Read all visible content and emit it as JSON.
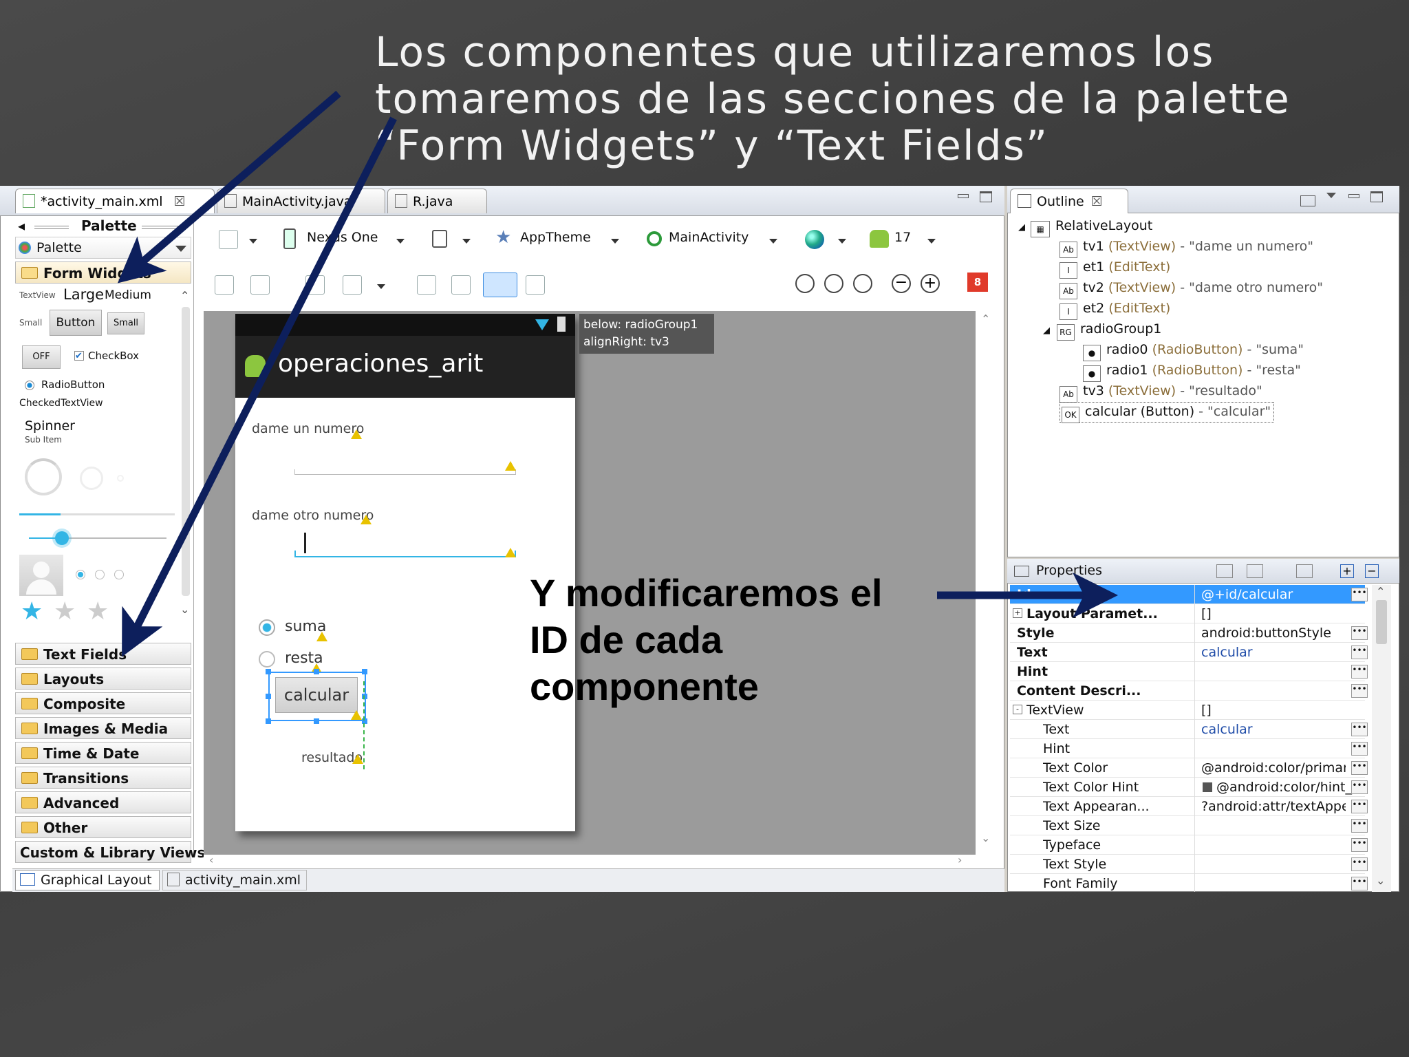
{
  "slide": {
    "title_lines": [
      "Los componentes que utilizaremos los",
      "tomaremos de las secciones de la palette",
      "“Form Widgets” y “Text Fields”"
    ],
    "note_lines": [
      "Y modificaremos el",
      "ID de cada",
      "componente"
    ]
  },
  "editor_tabs": [
    {
      "label": "*activity_main.xml",
      "close": "☒"
    },
    {
      "label": "MainActivity.java"
    },
    {
      "label": "R.java"
    }
  ],
  "palette": {
    "header": "Palette",
    "selector": "Palette",
    "open_category": "Form Widgets",
    "widgets": {
      "textview_small_label": "TextView",
      "large": "Large",
      "medium": "Medium",
      "small_label": "Small",
      "button": "Button",
      "small_button": "Small",
      "toggle_off": "OFF",
      "checkbox": "CheckBox",
      "radiobutton": "RadioButton",
      "checkedtextview": "CheckedTextView",
      "spinner": "Spinner",
      "sub_item": "Sub Item"
    },
    "categories": [
      "Text Fields",
      "Layouts",
      "Composite",
      "Images & Media",
      "Time & Date",
      "Transitions",
      "Advanced",
      "Other"
    ],
    "custom": "Custom & Library Views"
  },
  "toolbar": {
    "device": "Nexus One",
    "theme": "AppTheme",
    "activity": "MainActivity",
    "api": "17",
    "error_count": "8"
  },
  "canvas": {
    "app_title": "operaciones_arit",
    "tooltip_lines": [
      "below: radioGroup1",
      "alignRight: tv3"
    ],
    "tv1": "dame un numero",
    "tv2": "dame otro numero",
    "radio0": "suma",
    "radio1": "resta",
    "button": "calcular",
    "tv3": "resultado"
  },
  "bottom_tabs": [
    "Graphical Layout",
    "activity_main.xml"
  ],
  "outline": {
    "title": "Outline",
    "root": "RelativeLayout",
    "items": [
      {
        "id": "tv1",
        "type": "(TextView)",
        "text": "- \"dame un numero\"",
        "icon": "Ab",
        "indent": 1
      },
      {
        "id": "et1",
        "type": "(EditText)",
        "text": "",
        "icon": "I",
        "indent": 1
      },
      {
        "id": "tv2",
        "type": "(TextView)",
        "text": "- \"dame otro numero\"",
        "icon": "Ab",
        "indent": 1
      },
      {
        "id": "et2",
        "type": "(EditText)",
        "text": "",
        "icon": "I",
        "indent": 1
      },
      {
        "id": "radioGroup1",
        "type": "",
        "text": "",
        "icon": "RG",
        "indent": 1
      },
      {
        "id": "radio0",
        "type": "(RadioButton)",
        "text": "- \"suma\"",
        "icon": "●",
        "indent": 2
      },
      {
        "id": "radio1",
        "type": "(RadioButton)",
        "text": "- \"resta\"",
        "icon": "●",
        "indent": 2
      },
      {
        "id": "tv3",
        "type": "(TextView)",
        "text": "- \"resultado\"",
        "icon": "Ab",
        "indent": 1
      },
      {
        "id": "calcular",
        "type": "(Button)",
        "text": "- \"calcular\"",
        "icon": "OK",
        "indent": 1
      }
    ]
  },
  "properties": {
    "title": "Properties",
    "rows": [
      {
        "name": "Id",
        "value": "@+id/calcular",
        "bold": true,
        "selected": true
      },
      {
        "name": "Layout Paramet...",
        "value": "[]",
        "bold": true,
        "expander": "+"
      },
      {
        "name": "Style",
        "value": "android:buttonStyle",
        "bold": true
      },
      {
        "name": "Text",
        "value": "calcular",
        "bold": true,
        "blue": true
      },
      {
        "name": "Hint",
        "value": "",
        "bold": true
      },
      {
        "name": "Content Descri...",
        "value": "",
        "bold": true
      },
      {
        "name": "TextView",
        "value": "[]",
        "expander": "-"
      },
      {
        "name": "Text",
        "value": "calcular",
        "indent": true,
        "blue": true
      },
      {
        "name": "Hint",
        "value": "",
        "indent": true
      },
      {
        "name": "Text Color",
        "value": "@android:color/primary_t...",
        "indent": true
      },
      {
        "name": "Text Color Hint",
        "value": "@android:color/hint_fo...",
        "indent": true,
        "swatch": "#555555"
      },
      {
        "name": "Text Appearan...",
        "value": "?android:attr/textAppeara...",
        "indent": true
      },
      {
        "name": "Text Size",
        "value": "",
        "indent": true
      },
      {
        "name": "Typeface",
        "value": "",
        "indent": true
      },
      {
        "name": "Text Style",
        "value": "",
        "indent": true
      },
      {
        "name": "Font Family",
        "value": "",
        "indent": true
      }
    ]
  },
  "colors": {
    "arrow": "#0d1f5c",
    "selection": "#3399ff",
    "accent_blue": "#33b5e5"
  }
}
